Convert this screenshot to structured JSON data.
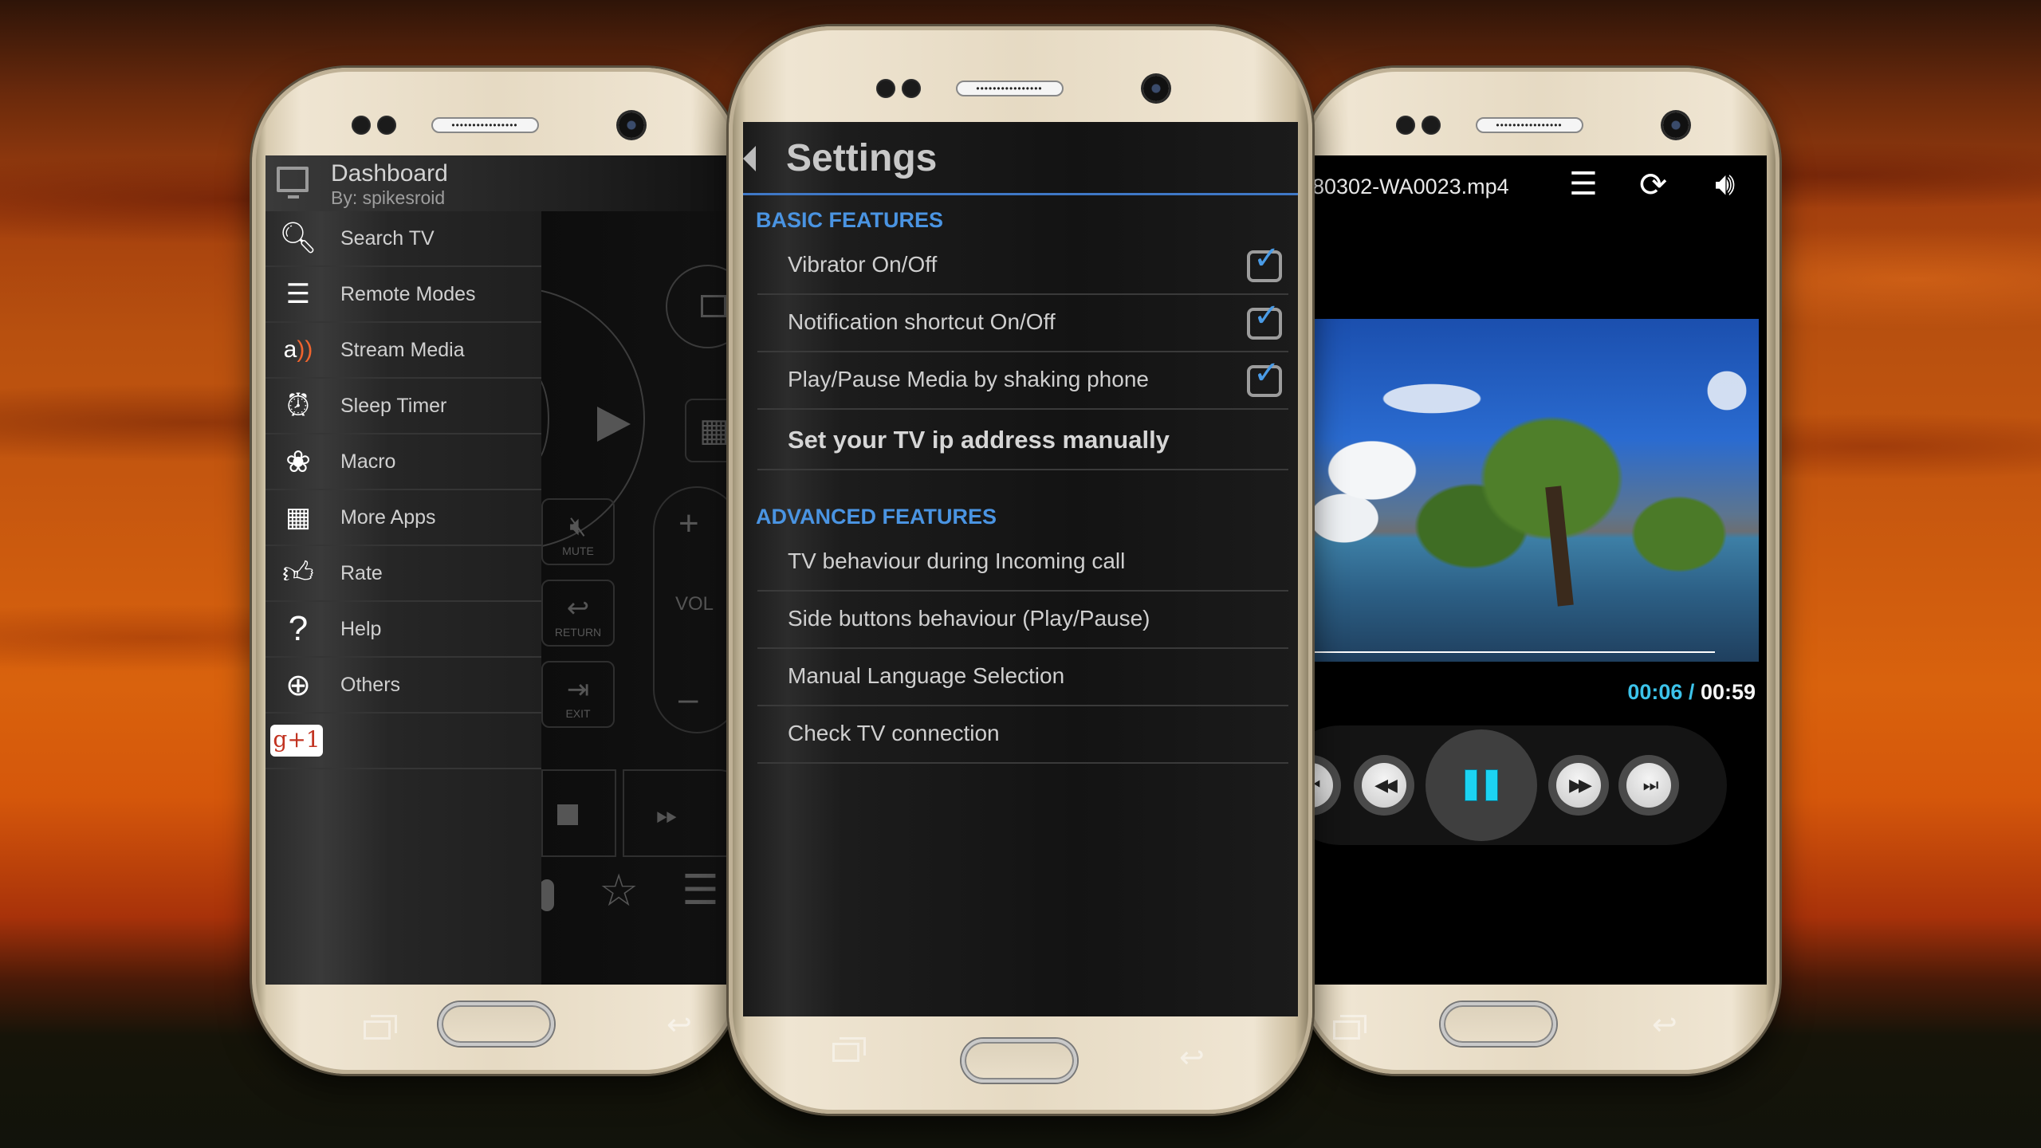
{
  "left_phone": {
    "drawer": {
      "title": "Dashboard",
      "subtitle": "By: spikesroid",
      "items": [
        {
          "label": "Search TV",
          "icon": "search-tv-icon"
        },
        {
          "label": "Remote Modes",
          "icon": "sliders-icon"
        },
        {
          "label": "Stream Media",
          "icon": "stream-media-icon"
        },
        {
          "label": "Sleep Timer",
          "icon": "alarm-clock-icon"
        },
        {
          "label": "Macro",
          "icon": "lotus-icon"
        },
        {
          "label": "More Apps",
          "icon": "grid-icon"
        },
        {
          "label": "Rate",
          "icon": "thumbs-up-icon"
        },
        {
          "label": "Help",
          "icon": "question-icon"
        },
        {
          "label": "Others",
          "icon": "plus-circle-icon"
        }
      ],
      "gplus_label": "g+1"
    },
    "remote": {
      "mute_label": "MUTE",
      "return_label": "RETURN",
      "exit_label": "EXIT",
      "vol_label": "VOL",
      "vol_plus": "+",
      "vol_minus": "–"
    }
  },
  "center_phone": {
    "title": "Settings",
    "sections": [
      {
        "title": "BASIC FEATURES",
        "items": [
          {
            "label": "Vibrator On/Off",
            "checked": true
          },
          {
            "label": "Notification shortcut On/Off",
            "checked": true
          },
          {
            "label": "Play/Pause Media by shaking phone",
            "checked": true
          },
          {
            "label": "Set your TV ip address manually",
            "bold": true
          }
        ]
      },
      {
        "title": "ADVANCED FEATURES",
        "items": [
          {
            "label": "TV behaviour during Incoming call"
          },
          {
            "label": "Side buttons behaviour (Play/Pause)"
          },
          {
            "label": "Manual Language Selection"
          },
          {
            "label": "Check TV connection"
          }
        ]
      }
    ],
    "accent_color": "#4a94e2"
  },
  "right_phone": {
    "file_name": "80302-WA0023.mp4",
    "toolbar": {
      "playlist_icon": "playlist-icon",
      "rotate_icon": "screen-rotate-icon",
      "volume_icon": "volume-icon"
    },
    "time_current": "00:06",
    "time_separator": " / ",
    "time_total": "00:59",
    "progress_fraction": 0.1,
    "state": "playing",
    "accent_color": "#3cc3ea"
  }
}
